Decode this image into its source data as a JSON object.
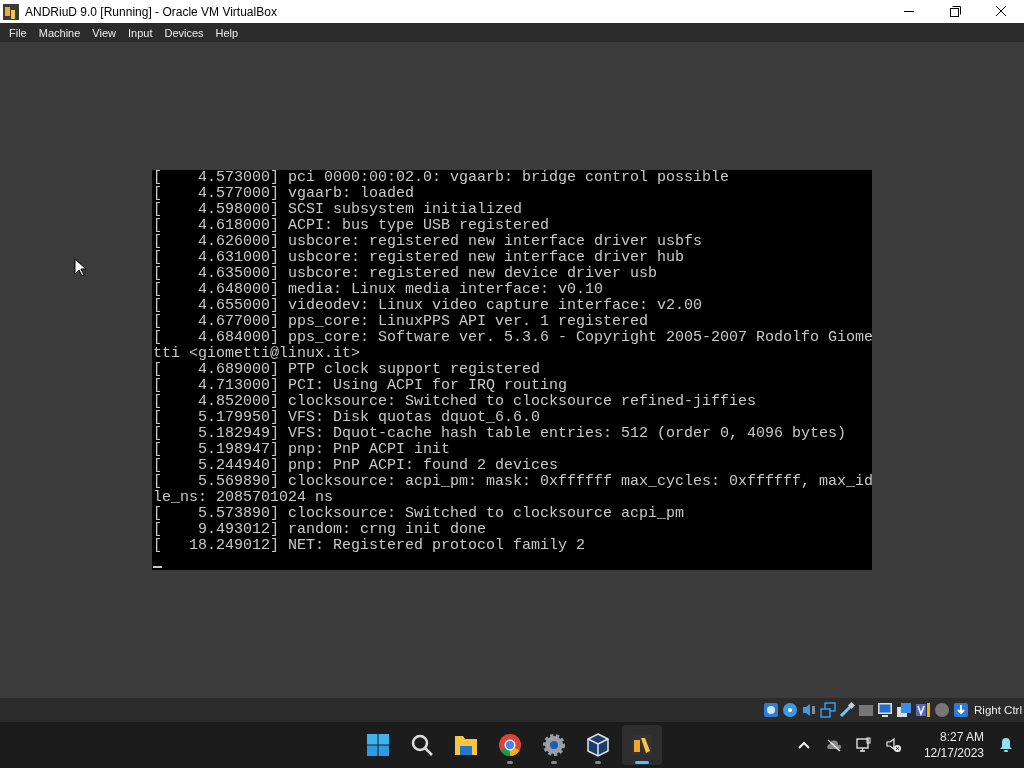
{
  "window": {
    "title": "ANDRiuD 9.0 [Running] - Oracle VM VirtualBox"
  },
  "menu": [
    "File",
    "Machine",
    "View",
    "Input",
    "Devices",
    "Help"
  ],
  "console": {
    "lines": [
      "[    4.573000] pci 0000:00:02.0: vgaarb: bridge control possible",
      "[    4.577000] vgaarb: loaded",
      "[    4.598000] SCSI subsystem initialized",
      "[    4.618000] ACPI: bus type USB registered",
      "[    4.626000] usbcore: registered new interface driver usbfs",
      "[    4.631000] usbcore: registered new interface driver hub",
      "[    4.635000] usbcore: registered new device driver usb",
      "[    4.648000] media: Linux media interface: v0.10",
      "[    4.655000] videodev: Linux video capture interface: v2.00",
      "[    4.677000] pps_core: LinuxPPS API ver. 1 registered",
      "[    4.684000] pps_core: Software ver. 5.3.6 - Copyright 2005-2007 Rodolfo Giome",
      "tti <giometti@linux.it>",
      "[    4.689000] PTP clock support registered",
      "[    4.713000] PCI: Using ACPI for IRQ routing",
      "[    4.852000] clocksource: Switched to clocksource refined-jiffies",
      "[    5.179950] VFS: Disk quotas dquot_6.6.0",
      "[    5.182949] VFS: Dquot-cache hash table entries: 512 (order 0, 4096 bytes)",
      "[    5.198947] pnp: PnP ACPI init",
      "[    5.244940] pnp: PnP ACPI: found 2 devices",
      "[    5.569890] clocksource: acpi_pm: mask: 0xffffff max_cycles: 0xffffff, max_id",
      "le_ns: 2085701024 ns",
      "[    5.573890] clocksource: Switched to clocksource acpi_pm",
      "[    9.493012] random: crng init done",
      "[   18.249012] NET: Registered protocol family 2"
    ]
  },
  "status_bar": {
    "host_key": "Right Ctrl"
  },
  "taskbar": {
    "apps": [
      {
        "kind": "start",
        "running": false,
        "selected": false
      },
      {
        "kind": "search",
        "running": false,
        "selected": false
      },
      {
        "kind": "folder",
        "running": false,
        "selected": false
      },
      {
        "kind": "browser",
        "running": true,
        "selected": false
      },
      {
        "kind": "settings",
        "running": true,
        "selected": false
      },
      {
        "kind": "cube",
        "running": true,
        "selected": false
      },
      {
        "kind": "vm",
        "running": true,
        "selected": true
      }
    ],
    "time": "8:27 AM",
    "date": "12/17/2023"
  }
}
